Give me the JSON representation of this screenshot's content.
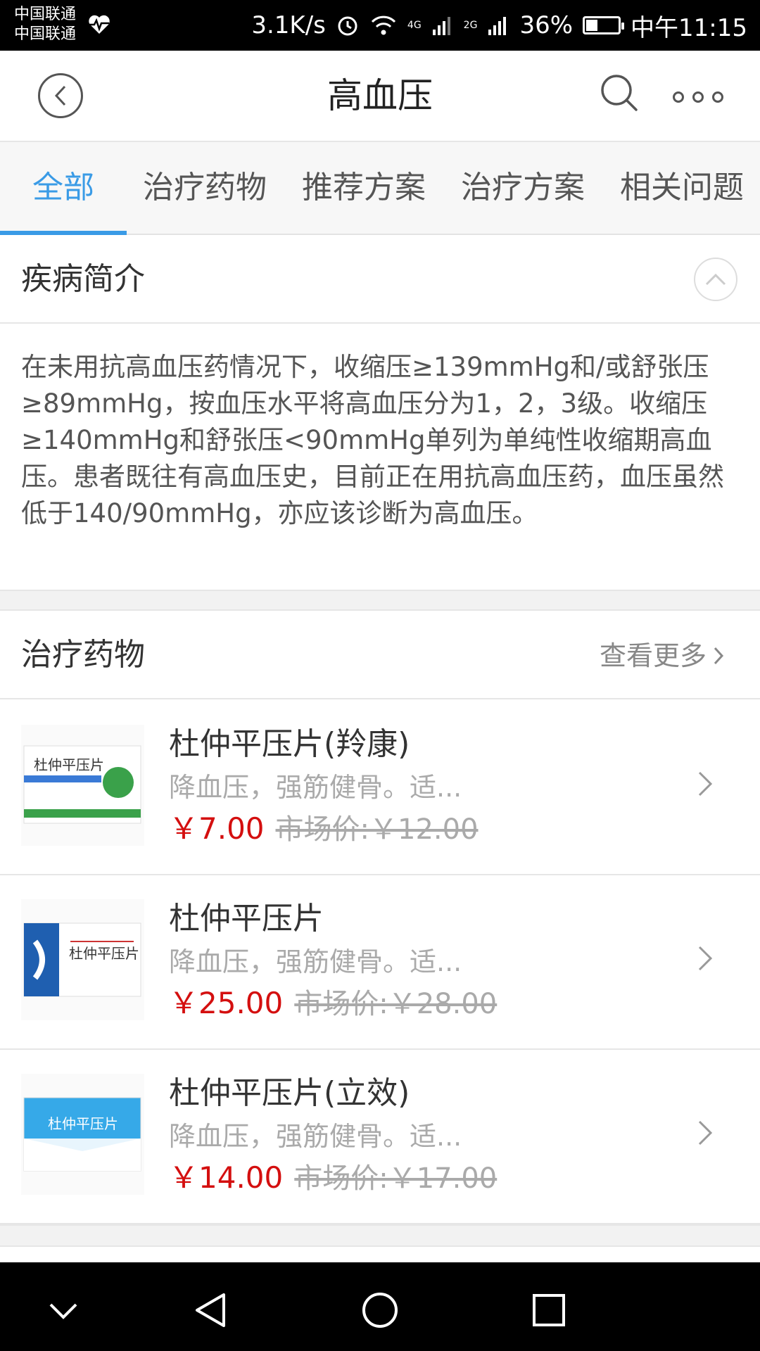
{
  "status_bar": {
    "carrier1": "中国联通",
    "carrier2": "中国联通",
    "speed": "3.1K/s",
    "net1": "4G",
    "net2": "2G",
    "battery": "36%",
    "battery_level": 0.36,
    "time": "中午11:15"
  },
  "header": {
    "title": "高血压"
  },
  "tabs": [
    {
      "label": "全部",
      "active": true
    },
    {
      "label": "治疗药物"
    },
    {
      "label": "推荐方案"
    },
    {
      "label": "治疗方案"
    },
    {
      "label": "相关问题"
    }
  ],
  "intro": {
    "title": "疾病简介",
    "text": "在未用抗高血压药情况下，收缩压≥139mmHg和/或舒张压≥89mmHg，按血压水平将高血压分为1，2，3级。收缩压≥140mmHg和舒张压<90mmHg单列为单纯性收缩期高血压。患者既往有高血压史，目前正在用抗高血压药，血压虽然低于140/90mmHg，亦应该诊断为高血压。"
  },
  "drugs_section": {
    "title": "治疗药物",
    "more_label": "查看更多",
    "items": [
      {
        "name": "杜仲平压片(羚康)",
        "desc": "降血压，强筋健骨。适...",
        "price": "￥7.00",
        "market_price": "市场价:￥12.00",
        "box_text": "杜仲平压片"
      },
      {
        "name": "杜仲平压片",
        "desc": "降血压，强筋健骨。适...",
        "price": "￥25.00",
        "market_price": "市场价:￥28.00",
        "box_text": "杜仲平压片"
      },
      {
        "name": "杜仲平压片(立效)",
        "desc": "降血压，强筋健骨。适...",
        "price": "￥14.00",
        "market_price": "市场价:￥17.00",
        "box_text": "杜仲平压片"
      }
    ]
  },
  "icons": {
    "back": "chevron-left-circle-icon",
    "search": "search-icon",
    "more": "more-dots-icon",
    "collapse": "chevron-up-circle-icon",
    "row_arrow": "chevron-right-icon"
  },
  "colors": {
    "accent": "#3a9be6",
    "price": "#d40f0f"
  }
}
